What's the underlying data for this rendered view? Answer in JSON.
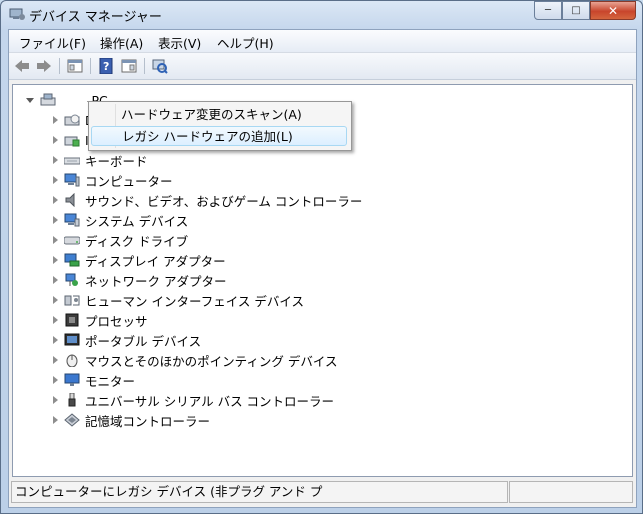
{
  "window": {
    "title": "デバイス マネージャー",
    "min": "─",
    "max": "□",
    "close": "✕"
  },
  "menu": [
    "ファイル(F)",
    "操作(A)",
    "表示(V)",
    "ヘルプ(H)"
  ],
  "toolbar": [
    "back-icon",
    "forward-icon",
    "properties-icon",
    "help-icon",
    "action-icon",
    "scan-icon"
  ],
  "tree": {
    "root": "-PC",
    "items": [
      {
        "label": "DV",
        "icon": "dvd-icon"
      },
      {
        "label": "ID",
        "icon": "ide-icon"
      },
      {
        "label": "キーボード",
        "icon": "keyboard-icon"
      },
      {
        "label": "コンピューター",
        "icon": "computer-icon"
      },
      {
        "label": "サウンド、ビデオ、およびゲーム コントローラー",
        "icon": "sound-icon"
      },
      {
        "label": "システム デバイス",
        "icon": "system-icon"
      },
      {
        "label": "ディスク ドライブ",
        "icon": "disk-icon"
      },
      {
        "label": "ディスプレイ アダプター",
        "icon": "display-icon"
      },
      {
        "label": "ネットワーク アダプター",
        "icon": "network-icon"
      },
      {
        "label": "ヒューマン インターフェイス デバイス",
        "icon": "hid-icon"
      },
      {
        "label": "プロセッサ",
        "icon": "processor-icon"
      },
      {
        "label": "ポータブル デバイス",
        "icon": "portable-icon"
      },
      {
        "label": "マウスとそのほかのポインティング デバイス",
        "icon": "mouse-icon"
      },
      {
        "label": "モニター",
        "icon": "monitor-icon"
      },
      {
        "label": "ユニバーサル シリアル バス コントローラー",
        "icon": "usb-icon"
      },
      {
        "label": "記憶域コントローラー",
        "icon": "storage-icon"
      }
    ]
  },
  "context_menu": [
    {
      "label": "ハードウェア変更のスキャン(A)",
      "highlighted": false
    },
    {
      "label": "レガシ ハードウェアの追加(L)",
      "highlighted": true
    }
  ],
  "status": "コンピューターにレガシ デバイス (非プラグ アンド プ"
}
